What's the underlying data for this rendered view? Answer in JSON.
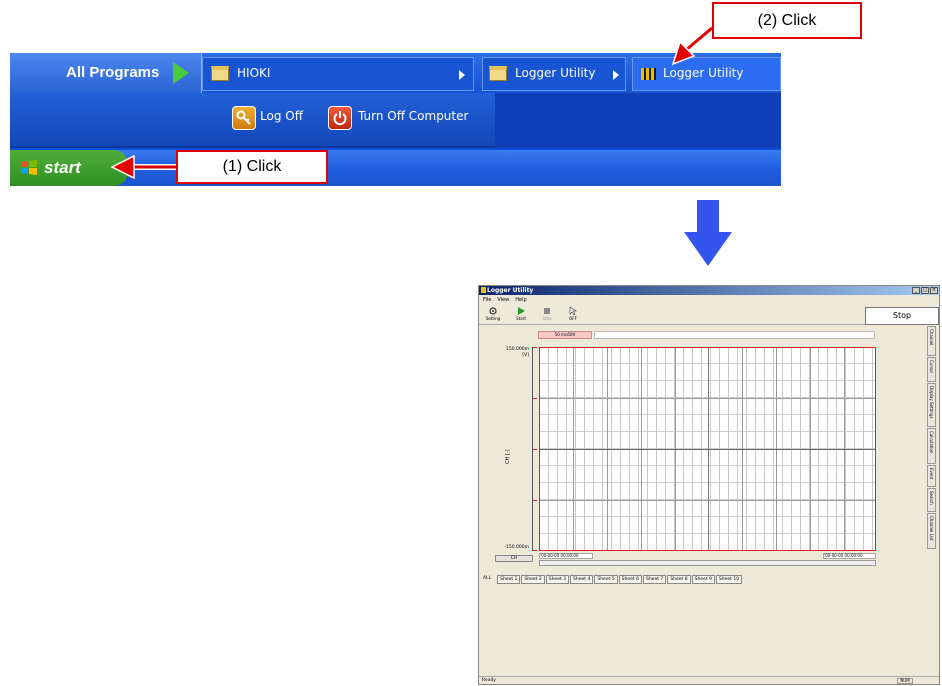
{
  "start_menu": {
    "all_programs_label": "All Programs",
    "submenu_1_label": "HIOKI",
    "submenu_2_label": "Logger Utility",
    "submenu_3_label": "Logger Utility",
    "log_off_label": "Log Off",
    "turn_off_label": "Turn Off Computer",
    "start_label": "start"
  },
  "callouts": {
    "step1": "(1) Click",
    "step2": "(2) Click"
  },
  "app": {
    "title": "Logger Utility",
    "menu": [
      "File",
      "View",
      "Help"
    ],
    "toolbar": {
      "setting": "Setting",
      "start": "Start",
      "stop": "Stop",
      "off": "OFF"
    },
    "status_panel": "Stop",
    "time_div": "50 ms/DIV",
    "y_top_value": "150.000m",
    "y_unit": "[V]",
    "y_bottom_value": "-150.000m",
    "channel_axis_label": "CH [-]",
    "channel_button": "CH",
    "timestamp_left": "'00-00-00 00:00:00",
    "timestamp_right": "'00-00-00 00:00:00",
    "side_tabs": [
      "Channel",
      "Cursor",
      "Display Settings",
      "Calculation",
      "Event",
      "Search",
      "Channel List"
    ],
    "sheet_tabs": [
      "ALL",
      "Sheet 1",
      "Sheet 2",
      "Sheet 3",
      "Sheet 4",
      "Sheet 5",
      "Sheet 6",
      "Sheet 7",
      "Sheet 8",
      "Sheet 9",
      "Sheet 10"
    ],
    "status_text": "Ready",
    "num_indicator": "NUM"
  },
  "colors": {
    "callout_border": "#e00000",
    "down_arrow": "#3355ee",
    "taskbar": "#1f5ee0",
    "start_button": "#2f8f22"
  }
}
